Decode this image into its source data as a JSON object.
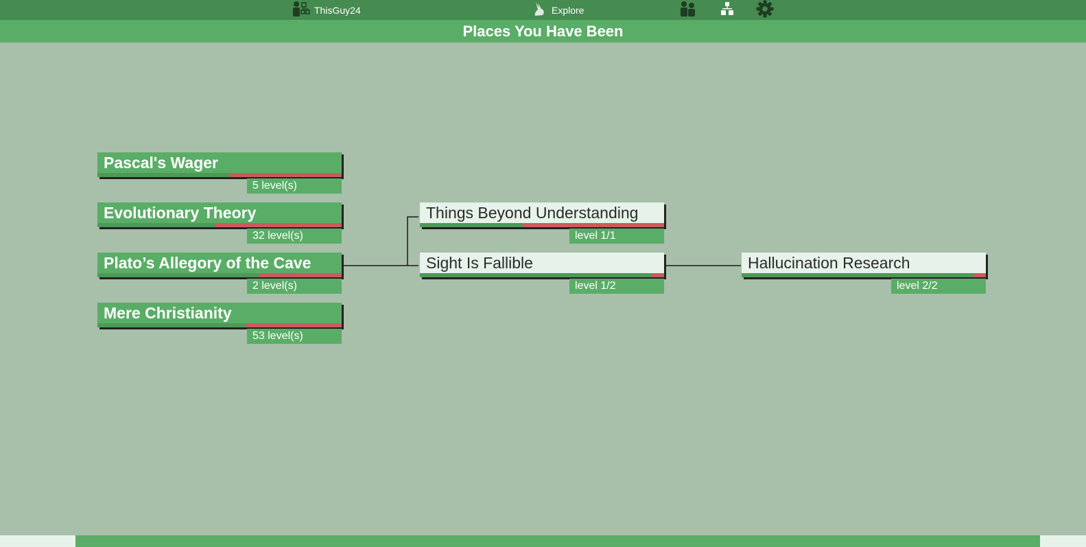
{
  "topbar": {
    "user": {
      "icon": "user-tree-icon",
      "label": "ThisGuy24"
    },
    "explore": {
      "icon": "rabbit-icon",
      "label": "Explore"
    },
    "icons": [
      "friends-icon",
      "hierarchy-icon",
      "gear-icon"
    ]
  },
  "title": "Places You Have Been",
  "roots": [
    {
      "label": "Pascal's Wager",
      "levels": "5 level(s)",
      "progress": 0.54
    },
    {
      "label": "Evolutionary Theory",
      "levels": "32 level(s)",
      "progress": 0.48
    },
    {
      "label": "Plato’s Allegory of the Cave",
      "levels": "2 level(s)",
      "progress": 0.66
    },
    {
      "label": "Mere Christianity",
      "levels": "53 level(s)",
      "progress": 0.61
    }
  ],
  "children": [
    {
      "label": "Things Beyond Understanding",
      "levels": "level 1/1",
      "progress": 0.42
    },
    {
      "label": "Sight Is Fallible",
      "levels": "level 1/2",
      "progress": 0.95
    }
  ],
  "grandchildren": [
    {
      "label": "Hallucination Research",
      "levels": "level 2/2",
      "progress": 0.95
    }
  ],
  "footer": {
    "progress": 0.89
  },
  "colors": {
    "background": "#a8bfaa",
    "nav": "#468b50",
    "accent": "#5aad67",
    "progress_done": "#4c9a56",
    "progress_remaining": "#ce5a5a",
    "child_box": "#e6f2ea"
  }
}
